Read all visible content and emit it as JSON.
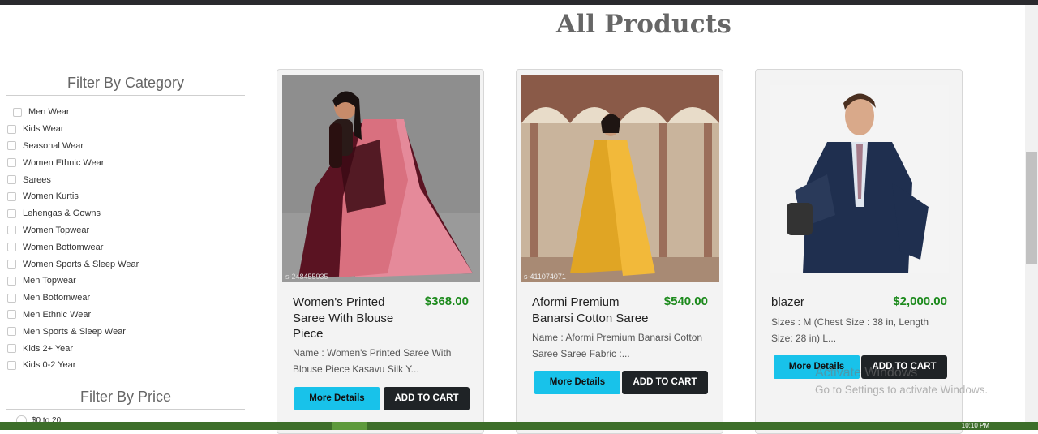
{
  "page": {
    "title": "All Products"
  },
  "sidebar": {
    "category_title": "Filter By Category",
    "categories": [
      "Men Wear",
      "Kids Wear",
      "Seasonal Wear",
      "Women Ethnic Wear",
      "Sarees",
      "Women Kurtis",
      "Lehengas & Gowns",
      "Women Topwear",
      "Women Bottomwear",
      "Women Sports & Sleep Wear",
      "Men Topwear",
      "Men Bottomwear",
      "Men Ethnic Wear",
      "Men Sports & Sleep Wear",
      "Kids 2+ Year",
      "Kids 0-2 Year"
    ],
    "price_title": "Filter By Price",
    "price_first_option": "$0 to 20"
  },
  "products": [
    {
      "name": "Women's Printed Saree With Blouse Piece",
      "price": "$368.00",
      "description": "Name : Women's Printed Saree With Blouse Piece Kasavu Silk Y...",
      "image_caption": "s-248455935",
      "more_label": "More Details",
      "cart_label": "ADD TO CART"
    },
    {
      "name": "Aformi Premium Banarsi Cotton Saree",
      "price": "$540.00",
      "description": "Name : Aformi Premium Banarsi Cotton Saree  Saree Fabric :...",
      "image_caption": "s-411074071",
      "more_label": "More Details",
      "cart_label": "ADD TO CART"
    },
    {
      "name": "blazer",
      "price": "$2,000.00",
      "description": "Sizes :   M (Chest Size : 38 in, Length Size: 28 in)  L...",
      "more_label": "More Details",
      "cart_label": "ADD TO CART"
    }
  ],
  "watermark": {
    "line1": "Activate Windows",
    "line2": "Go to Settings to activate Windows."
  },
  "taskbar": {
    "clock": "10:10 PM"
  },
  "colors": {
    "accent_button": "#18c2ea",
    "dark_button": "#1f2326",
    "price_green": "#1c8a1c"
  }
}
